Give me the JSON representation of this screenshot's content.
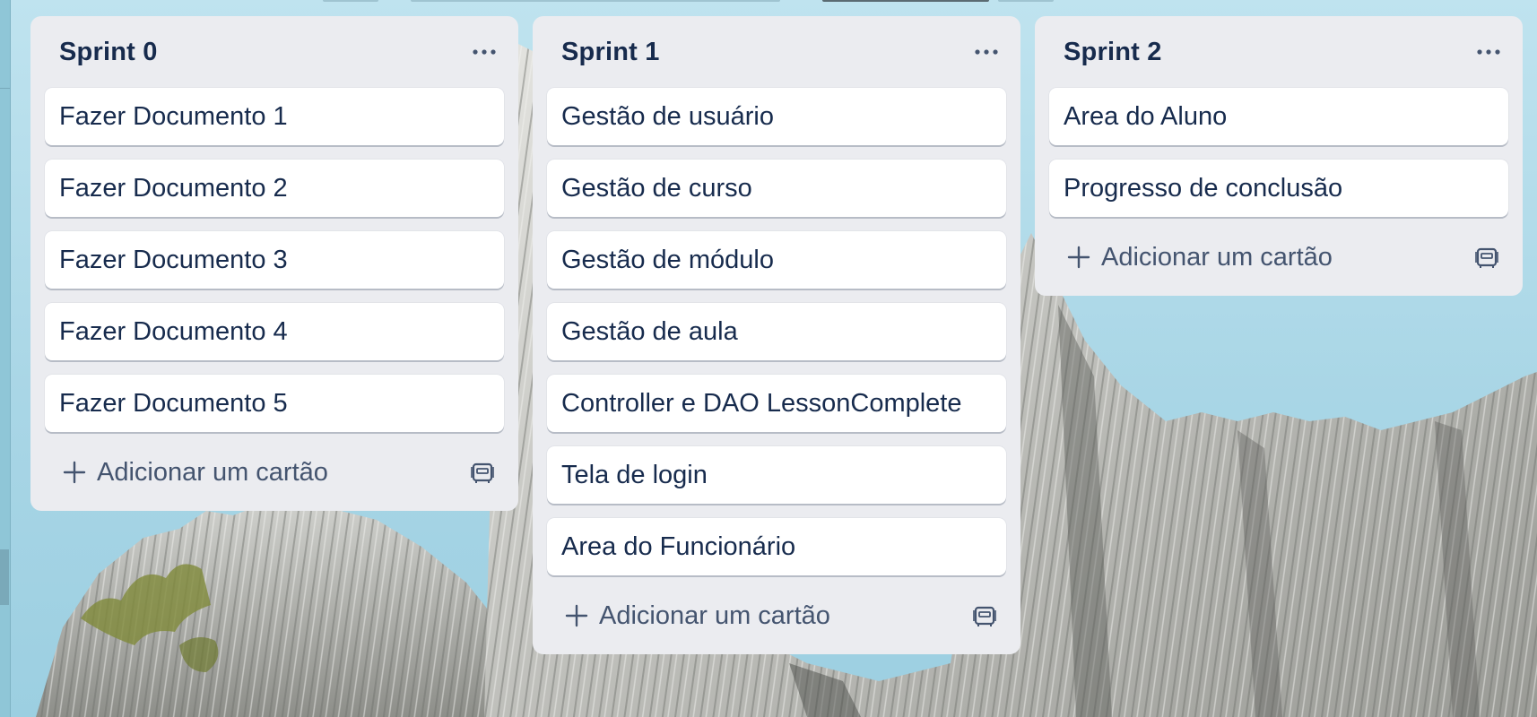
{
  "lists": [
    {
      "title": "Sprint 0",
      "cards": [
        {
          "title": "Fazer Documento 1"
        },
        {
          "title": "Fazer Documento 2"
        },
        {
          "title": "Fazer Documento 3"
        },
        {
          "title": "Fazer Documento 4"
        },
        {
          "title": "Fazer Documento 5"
        }
      ],
      "add_card_label": "Adicionar um cartão"
    },
    {
      "title": "Sprint 1",
      "cards": [
        {
          "title": "Gestão de usuário"
        },
        {
          "title": "Gestão de curso"
        },
        {
          "title": "Gestão de módulo"
        },
        {
          "title": "Gestão de aula"
        },
        {
          "title": "Controller e DAO LessonComplete"
        },
        {
          "title": "Tela de login"
        },
        {
          "title": "Area do Funcionário"
        }
      ],
      "add_card_label": "Adicionar um cartão"
    },
    {
      "title": "Sprint 2",
      "cards": [
        {
          "title": "Area do Aluno"
        },
        {
          "title": "Progresso de conclusão"
        }
      ],
      "add_card_label": "Adicionar um cartão"
    }
  ],
  "icons": {
    "list_menu": "more-horizontal-icon",
    "add_card": "plus-icon",
    "template": "card-template-icon",
    "background": "mountain-background-image"
  },
  "colors": {
    "list_background": "#ebecf0",
    "card_background": "#ffffff",
    "text_primary": "#172b4d",
    "text_secondary": "#44546f",
    "sky": "#a9d6e6"
  }
}
